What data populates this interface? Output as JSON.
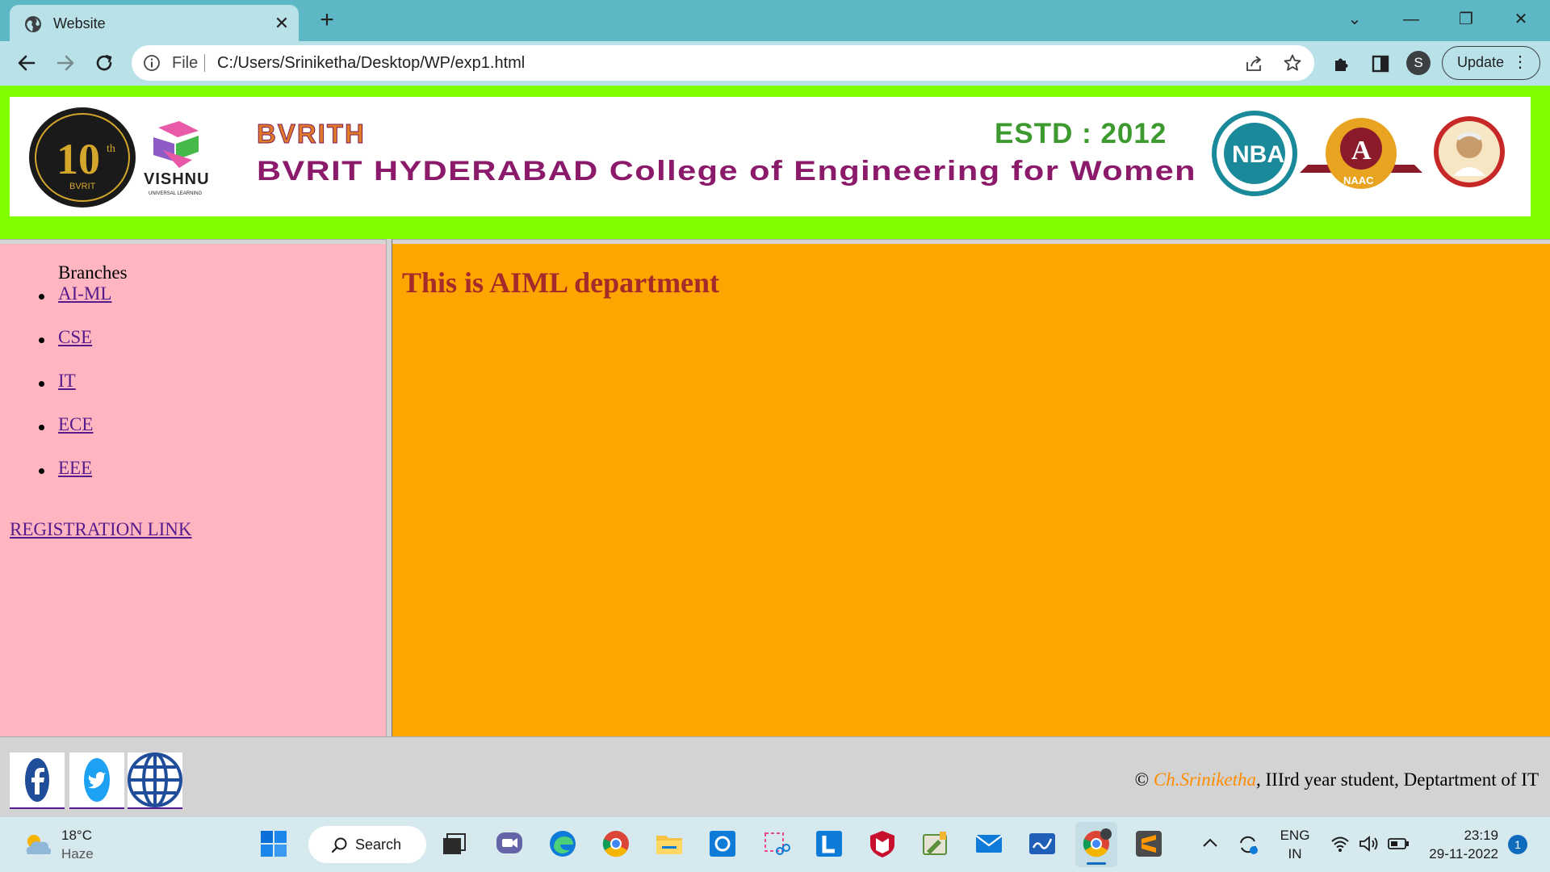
{
  "browser": {
    "tab_title": "Website",
    "close_glyph": "✕",
    "newtab_glyph": "+",
    "omnibox_scheme": "File",
    "omnibox_url": "C:/Users/Sriniketha/Desktop/WP/exp1.html",
    "profile_initial": "S",
    "update_label": "Update",
    "window_controls": [
      "⌄",
      "—",
      "❐",
      "✕"
    ]
  },
  "banner": {
    "anniversary": "10",
    "anniversary_sup": "th",
    "anniversary_sub": "BVRIT",
    "vishnu_label": "VISHNU",
    "vishnu_sub": "UNIVERSAL LEARNING",
    "short_name": "BVRITH",
    "college_name": "BVRIT HYDERABAD College of Engineering for Women",
    "estd": "ESTD : 2012",
    "nba_badge": "NBA",
    "naac_grade": "A",
    "naac_label": "NAAC"
  },
  "sidebar": {
    "title": "Branches",
    "branches": [
      {
        "label": "AI-ML"
      },
      {
        "label": "CSE"
      },
      {
        "label": "IT"
      },
      {
        "label": "ECE"
      },
      {
        "label": "EEE"
      }
    ],
    "registration_link": "REGISTRATION LINK"
  },
  "main": {
    "heading": "This is AIML department"
  },
  "footer": {
    "copyright_symbol": "©",
    "author": "Ch.Sriniketha",
    "author_suffix": ", IIIrd year student, Deptartment of IT",
    "social_icons": [
      "facebook-icon",
      "twitter-icon",
      "globe-icon"
    ]
  },
  "taskbar": {
    "weather_temp": "18°C",
    "weather_desc": "Haze",
    "search_label": "Search",
    "language": "ENG",
    "region": "IN",
    "time": "23:19",
    "date": "29-11-2022",
    "notification_count": "1"
  },
  "colors": {
    "header_frame": "#80ff00",
    "sidebar_bg": "#ffb6c1",
    "main_bg": "#ffa500",
    "heading_color": "#a52a2a",
    "link_color": "#551a8b",
    "banner_purple": "#8b1a6b",
    "banner_green": "#3d9a2e"
  }
}
